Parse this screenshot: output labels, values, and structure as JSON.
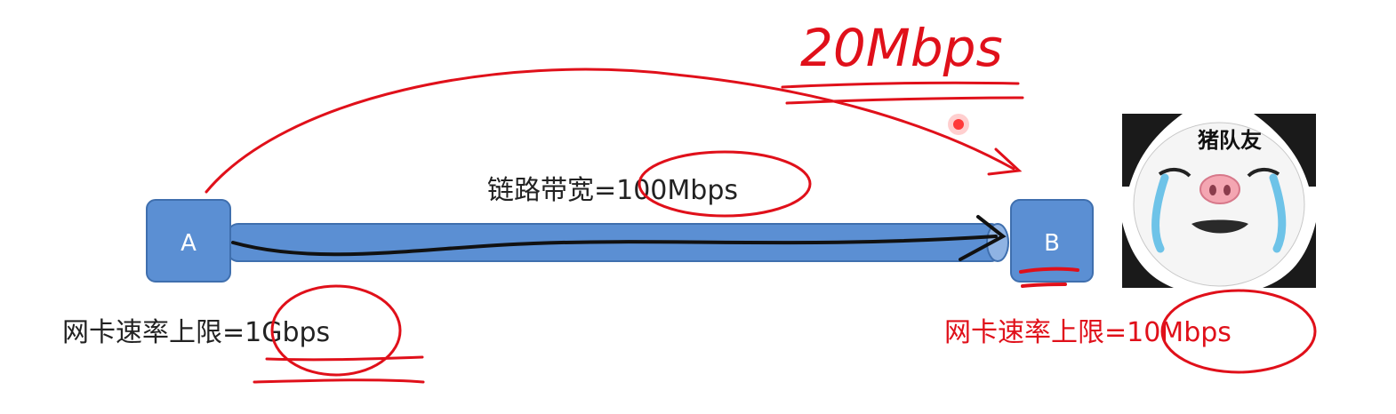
{
  "nodes": {
    "a": {
      "label": "A"
    },
    "b": {
      "label": "B"
    }
  },
  "link": {
    "label": "链路带宽=100Mbps"
  },
  "nic_a": {
    "label": "网卡速率上限=1Gbps"
  },
  "nic_b": {
    "label": "网卡速率上限=10Mbps"
  },
  "annotation": {
    "text": "20Mbps"
  },
  "meme": {
    "caption": "猪队友"
  },
  "colors": {
    "node_fill": "#5b8fd3",
    "node_stroke": "#3f6fae",
    "link_fill": "#5b8fd3",
    "ink_red": "#e0101a",
    "ink_black": "#111111"
  }
}
